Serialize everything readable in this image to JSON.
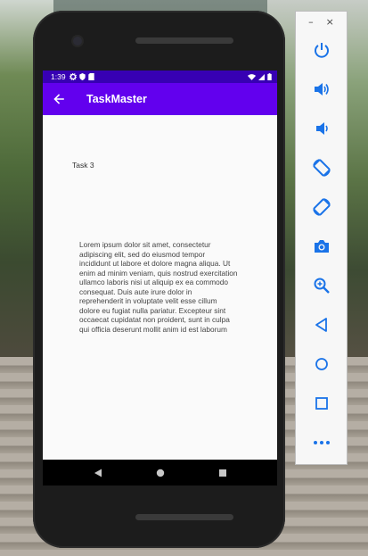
{
  "status_bar": {
    "time": "1:39",
    "left_icons": [
      "gear-icon",
      "shield-icon",
      "sd-card-icon"
    ],
    "right_icons": [
      "wifi-icon",
      "signal-icon",
      "battery-icon"
    ]
  },
  "app_bar": {
    "back_icon": "arrow-left-icon",
    "title": "TaskMaster"
  },
  "task": {
    "title": "Task 3",
    "body": "Lorem ipsum dolor sit amet, consectetur adipiscing elit, sed do eiusmod tempor incididunt ut labore et dolore magna aliqua. Ut enim ad minim veniam, quis nostrud exercitation ullamco laboris nisi ut aliquip ex ea commodo consequat. Duis aute irure dolor in reprehenderit in voluptate velit esse cillum dolore eu fugiat nulla pariatur. Excepteur sint occaecat cupidatat non proident, sunt in culpa qui officia deserunt mollit anim id est laborum"
  },
  "nav_bar": {
    "buttons": [
      "back-triangle-icon",
      "home-circle-icon",
      "recents-square-icon"
    ]
  },
  "emulator_panel": {
    "minimize_label": "–",
    "close_label": "×",
    "buttons": [
      "power-icon",
      "volume-up-icon",
      "volume-down-icon",
      "rotate-left-icon",
      "rotate-right-icon",
      "camera-icon",
      "zoom-icon",
      "back-icon",
      "home-icon",
      "overview-icon",
      "more-icon"
    ]
  },
  "colors": {
    "status_bar": "#3700b3",
    "app_bar": "#6200ee",
    "panel_icon": "#1a73e8",
    "content_bg": "#fafafa"
  }
}
